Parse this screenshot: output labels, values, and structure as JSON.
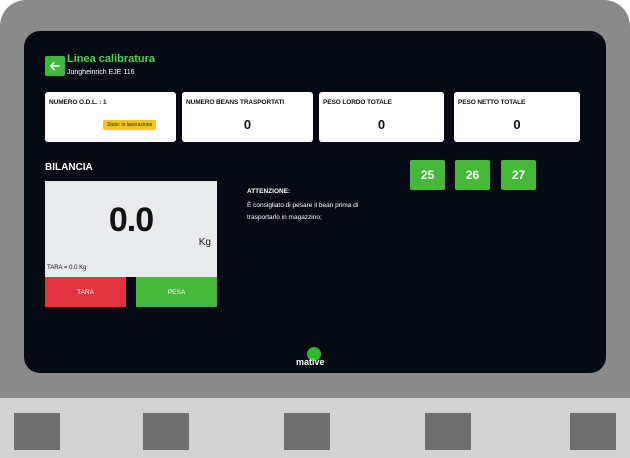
{
  "header": {
    "title": "Linea calibratura",
    "subtitle": "Jungheinrich EJE 116"
  },
  "cards": [
    {
      "label": "NUMERO O.D.L. : 1",
      "value": "",
      "badge": "Stato: in lavorazione"
    },
    {
      "label": "NUMERO BEANS TRASPORTATI",
      "value": "0"
    },
    {
      "label": "PESO LORDO TOTALE",
      "value": "0"
    },
    {
      "label": "PESO NETTO TOTALE",
      "value": "0"
    }
  ],
  "scale": {
    "section_label": "BILANCIA",
    "value": "0.0",
    "unit": "Kg",
    "tara_text": "TARA = 0.0 Kg",
    "tara_button": "TARA",
    "pesa_button": "PESA"
  },
  "notice": {
    "title": "ATTENZIONE:",
    "text": "È consigliato di pesare il bean prima di trasportarlo in magazzino;"
  },
  "beans": [
    "25",
    "26",
    "27"
  ],
  "brand": {
    "name": "mative"
  },
  "colors": {
    "accent_green": "#46b83a",
    "title_green": "#4cd64c",
    "danger_red": "#e0343e",
    "badge_yellow": "#f5c518",
    "screen_bg": "#050a14"
  },
  "icons": {
    "back": "arrow-left-icon"
  }
}
